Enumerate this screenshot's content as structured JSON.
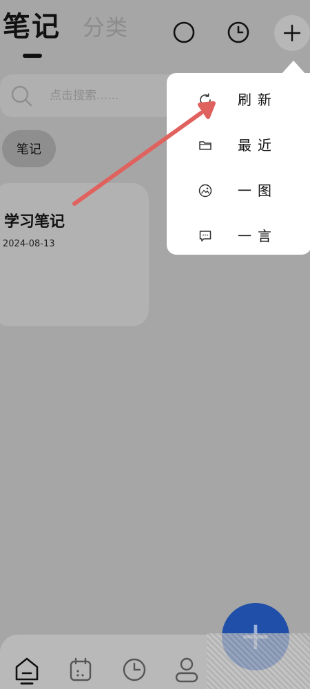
{
  "header": {
    "tab_notes": "笔记",
    "tab_category": "分类",
    "icons": [
      "circle-icon",
      "clock-icon",
      "plus-icon"
    ]
  },
  "search": {
    "placeholder": "点击搜索......"
  },
  "chip": {
    "label": "笔记"
  },
  "note": {
    "title": "学习笔记",
    "date": "2024-08-13"
  },
  "menu": {
    "items": [
      {
        "icon": "refresh-icon",
        "label": "刷新"
      },
      {
        "icon": "folder-icon",
        "label": "最近"
      },
      {
        "icon": "image-icon",
        "label": "一图"
      },
      {
        "icon": "message-icon",
        "label": "一言"
      }
    ]
  },
  "fab": {
    "icon": "plus-icon",
    "label": "+"
  },
  "bottom_nav": {
    "items": [
      {
        "icon": "home-icon"
      },
      {
        "icon": "calendar-icon"
      },
      {
        "icon": "timer-icon"
      },
      {
        "icon": "user-icon"
      }
    ]
  },
  "colors": {
    "background": "#a6a6a6",
    "fab": "#1f4fa8",
    "arrow": "#e0625e",
    "menu": "#ffffff"
  }
}
